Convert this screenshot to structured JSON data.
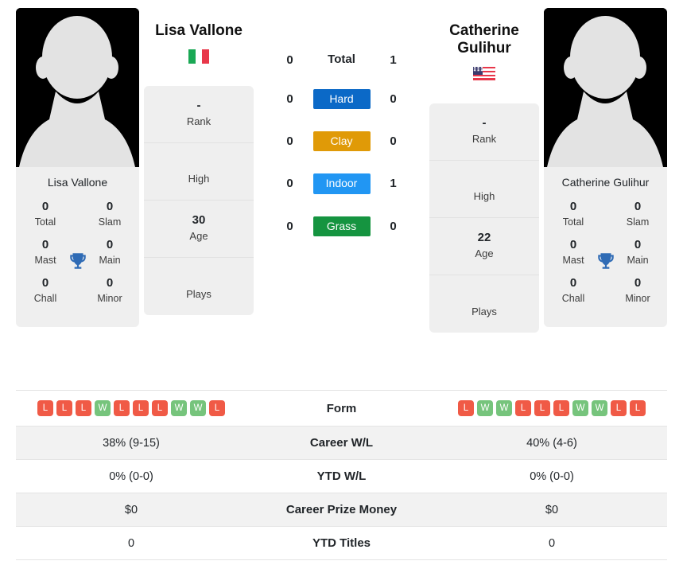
{
  "left_player": {
    "name": "Lisa Vallone",
    "caption": "Lisa Vallone",
    "country_code": "IT",
    "flag_name": "italy-flag",
    "avatar_name": "player-avatar-placeholder",
    "info": [
      {
        "value": "-",
        "label": "Rank"
      },
      {
        "value": "",
        "label": "High"
      },
      {
        "value": "30",
        "label": "Age"
      },
      {
        "value": "",
        "label": "Plays"
      }
    ],
    "titles": [
      {
        "value": "0",
        "label": "Total"
      },
      {
        "value": "0",
        "label": "Slam"
      },
      {
        "value": "0",
        "label": "Mast"
      },
      {
        "value": "0",
        "label": "Main"
      },
      {
        "value": "0",
        "label": "Chall"
      },
      {
        "value": "0",
        "label": "Minor"
      }
    ],
    "form": [
      "L",
      "L",
      "L",
      "W",
      "L",
      "L",
      "L",
      "W",
      "W",
      "L"
    ],
    "career_wl": "38% (9-15)",
    "ytd_wl": "0% (0-0)",
    "career_prize_money": "$0",
    "ytd_titles": "0"
  },
  "right_player": {
    "name": "Catherine Gulihur",
    "caption": "Catherine Gulihur",
    "country_code": "US",
    "flag_name": "usa-flag",
    "avatar_name": "player-avatar-placeholder",
    "info": [
      {
        "value": "-",
        "label": "Rank"
      },
      {
        "value": "",
        "label": "High"
      },
      {
        "value": "22",
        "label": "Age"
      },
      {
        "value": "",
        "label": "Plays"
      }
    ],
    "titles": [
      {
        "value": "0",
        "label": "Total"
      },
      {
        "value": "0",
        "label": "Slam"
      },
      {
        "value": "0",
        "label": "Mast"
      },
      {
        "value": "0",
        "label": "Main"
      },
      {
        "value": "0",
        "label": "Chall"
      },
      {
        "value": "0",
        "label": "Minor"
      }
    ],
    "form": [
      "L",
      "W",
      "W",
      "L",
      "L",
      "L",
      "W",
      "W",
      "L",
      "L"
    ],
    "career_wl": "40% (4-6)",
    "ytd_wl": "0% (0-0)",
    "career_prize_money": "$0",
    "ytd_titles": "0"
  },
  "head_to_head": [
    {
      "label": "Total",
      "type": "text",
      "left": "0",
      "right": "1",
      "color": ""
    },
    {
      "label": "Hard",
      "type": "badge",
      "left": "0",
      "right": "0",
      "color": "#0b69c7"
    },
    {
      "label": "Clay",
      "type": "badge",
      "left": "0",
      "right": "0",
      "color": "#e09a07"
    },
    {
      "label": "Indoor",
      "type": "badge",
      "left": "0",
      "right": "1",
      "color": "#2196f3"
    },
    {
      "label": "Grass",
      "type": "badge",
      "left": "0",
      "right": "0",
      "color": "#159440"
    }
  ],
  "table_labels": {
    "form": "Form",
    "career_wl": "Career W/L",
    "ytd_wl": "YTD W/L",
    "career_prize_money": "Career Prize Money",
    "ytd_titles": "YTD Titles"
  },
  "colors": {
    "win_badge": "#76c47c",
    "loss_badge": "#f05a46",
    "panel_bg": "#efefef",
    "row_shaded": "#f2f2f2"
  }
}
